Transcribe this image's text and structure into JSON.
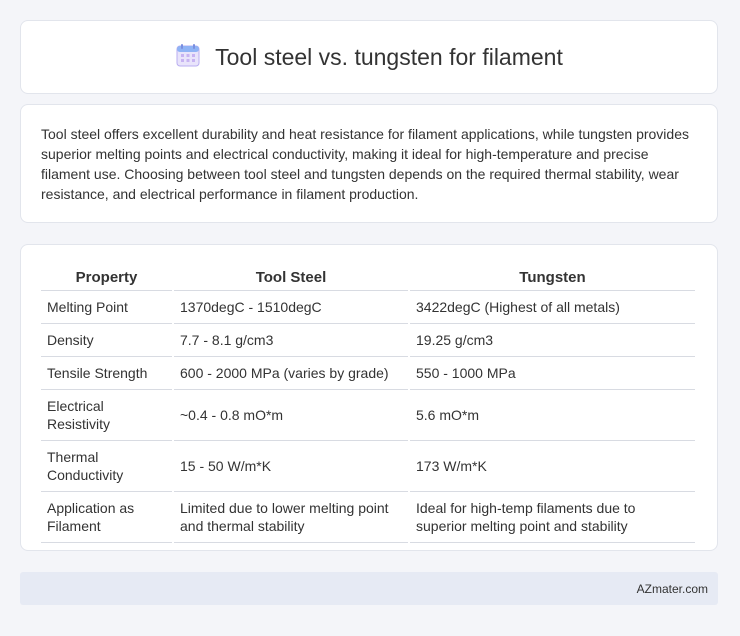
{
  "header": {
    "icon": "calendar-icon",
    "title": "Tool steel vs. tungsten for filament"
  },
  "intro": {
    "text": "Tool steel offers excellent durability and heat resistance for filament applications, while tungsten provides superior melting points and electrical conductivity, making it ideal for high-temperature and precise filament use. Choosing between tool steel and tungsten depends on the required thermal stability, wear resistance, and electrical performance in filament production."
  },
  "table": {
    "headers": [
      "Property",
      "Tool Steel",
      "Tungsten"
    ],
    "rows": [
      [
        "Melting Point",
        "1370degC - 1510degC",
        "3422degC (Highest of all metals)"
      ],
      [
        "Density",
        "7.7 - 8.1 g/cm3",
        "19.25 g/cm3"
      ],
      [
        "Tensile Strength",
        "600 - 2000 MPa (varies by grade)",
        "550 - 1000 MPa"
      ],
      [
        "Electrical Resistivity",
        "~0.4 - 0.8 mO*m",
        "5.6 mO*m"
      ],
      [
        "Thermal Conductivity",
        "15 - 50 W/m*K",
        "173 W/m*K"
      ],
      [
        "Application as Filament",
        "Limited due to lower melting point and thermal stability",
        "Ideal for high-temp filaments due to superior melting point and stability"
      ]
    ]
  },
  "footer": {
    "brand": "AZmater.com"
  }
}
